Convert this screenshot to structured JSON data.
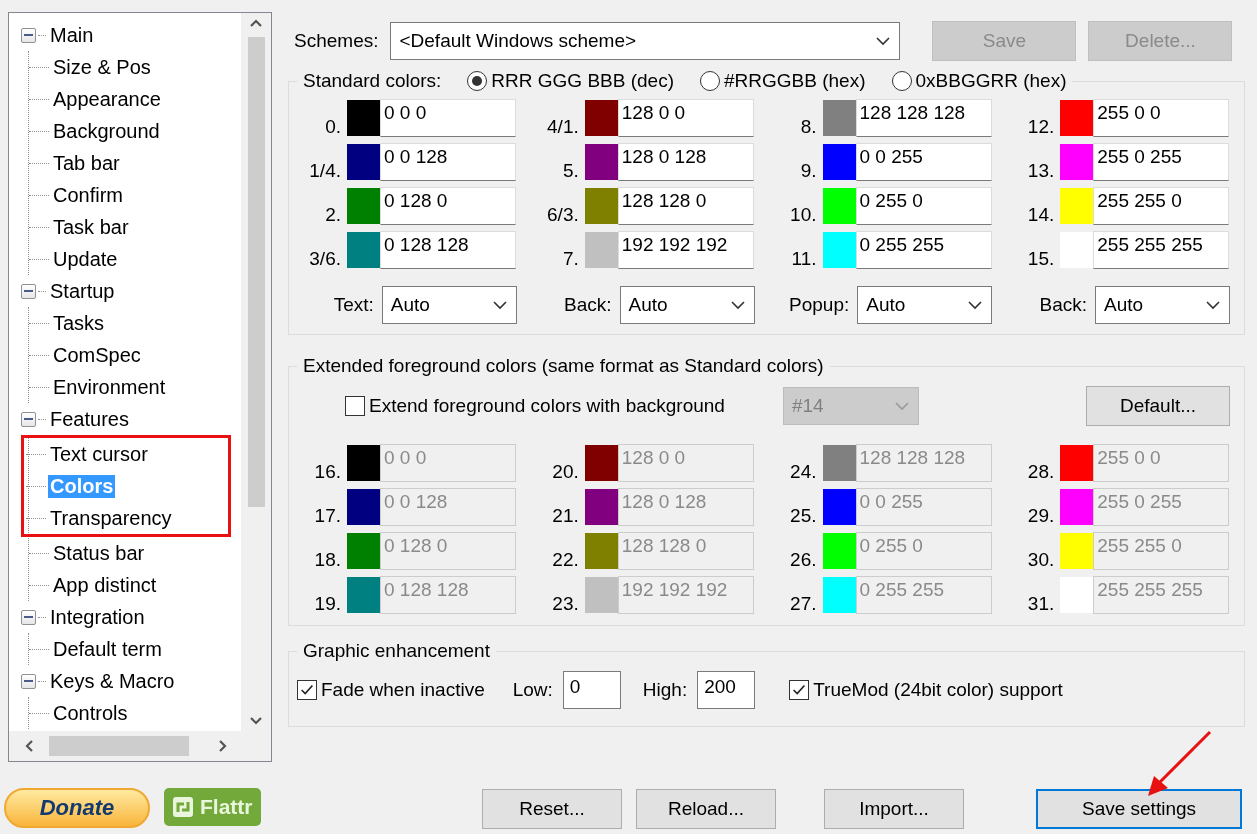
{
  "tree": [
    {
      "label": "Main",
      "expanded": true,
      "selected": false,
      "children": [
        {
          "label": "Size & Pos",
          "selected": false
        },
        {
          "label": "Appearance",
          "selected": false
        },
        {
          "label": "Background",
          "selected": false
        },
        {
          "label": "Tab bar",
          "selected": false
        },
        {
          "label": "Confirm",
          "selected": false
        },
        {
          "label": "Task bar",
          "selected": false
        },
        {
          "label": "Update",
          "selected": false
        }
      ]
    },
    {
      "label": "Startup",
      "expanded": true,
      "selected": false,
      "children": [
        {
          "label": "Tasks",
          "selected": false
        },
        {
          "label": "ComSpec",
          "selected": false
        },
        {
          "label": "Environment",
          "selected": false
        }
      ]
    },
    {
      "label": "Features",
      "expanded": true,
      "selected": false,
      "children": [
        {
          "label": "Text cursor",
          "selected": false,
          "framed": true
        },
        {
          "label": "Colors",
          "selected": true,
          "framed": true
        },
        {
          "label": "Transparency",
          "selected": false,
          "framed": true
        },
        {
          "label": "Status bar",
          "selected": false,
          "framed": false
        },
        {
          "label": "App distinct",
          "selected": false,
          "framed": false
        }
      ]
    },
    {
      "label": "Integration",
      "expanded": true,
      "selected": false,
      "children": [
        {
          "label": "Default term",
          "selected": false
        }
      ]
    },
    {
      "label": "Keys & Macro",
      "expanded": true,
      "selected": false,
      "children": [
        {
          "label": "Controls",
          "selected": false
        }
      ]
    }
  ],
  "side_buttons": [
    {
      "kind": "donate",
      "label": "Donate"
    },
    {
      "kind": "flattr",
      "label": "Flattr"
    }
  ],
  "schemes": {
    "label": "Schemes:",
    "value": "<Default Windows scheme>",
    "buttons": [
      {
        "label": "Save",
        "disabled": true
      },
      {
        "label": "Delete...",
        "disabled": true
      }
    ]
  },
  "standard": {
    "title": "Standard colors:",
    "fields_disabled": false,
    "formats": [
      {
        "label": "RRR GGG BBB (dec)",
        "selected": true
      },
      {
        "label": "#RRGGBB (hex)",
        "selected": false
      },
      {
        "label": "0xBBGGRR (hex)",
        "selected": false
      }
    ],
    "colors": [
      {
        "label": "0.",
        "color": "#000000",
        "value": "0 0 0"
      },
      {
        "label": "4/1.",
        "color": "#800000",
        "value": "128 0 0"
      },
      {
        "label": "8.",
        "color": "#808080",
        "value": "128 128 128"
      },
      {
        "label": "12.",
        "color": "#ff0000",
        "value": "255 0 0"
      },
      {
        "label": "1/4.",
        "color": "#000080",
        "value": "0 0 128"
      },
      {
        "label": "5.",
        "color": "#800080",
        "value": "128 0 128"
      },
      {
        "label": "9.",
        "color": "#0000ff",
        "value": "0 0 255"
      },
      {
        "label": "13.",
        "color": "#ff00ff",
        "value": "255 0 255"
      },
      {
        "label": "2.",
        "color": "#008000",
        "value": "0 128 0"
      },
      {
        "label": "6/3.",
        "color": "#808000",
        "value": "128 128 0"
      },
      {
        "label": "10.",
        "color": "#00ff00",
        "value": "0 255 0"
      },
      {
        "label": "14.",
        "color": "#ffff00",
        "value": "255 255 0"
      },
      {
        "label": "3/6.",
        "color": "#008080",
        "value": "0 128 128"
      },
      {
        "label": "7.",
        "color": "#c0c0c0",
        "value": "192 192 192"
      },
      {
        "label": "11.",
        "color": "#00ffff",
        "value": "0 255 255"
      },
      {
        "label": "15.",
        "color": "#ffffff",
        "value": "255 255 255"
      }
    ],
    "dropdowns": [
      {
        "label": "Text:",
        "value": "Auto"
      },
      {
        "label": "Back:",
        "value": "Auto"
      },
      {
        "label": "Popup:",
        "value": "Auto"
      },
      {
        "label": "Back:",
        "value": "Auto"
      }
    ]
  },
  "extended": {
    "title": "Extended foreground colors (same format as Standard colors)",
    "fields_disabled": true,
    "checkbox": {
      "label": "Extend foreground colors with background",
      "checked": false
    },
    "dropdown": {
      "value": "#14",
      "disabled": true
    },
    "button": "Default...",
    "colors": [
      {
        "label": "16.",
        "color": "#000000",
        "value": "0 0 0"
      },
      {
        "label": "20.",
        "color": "#800000",
        "value": "128 0 0"
      },
      {
        "label": "24.",
        "color": "#808080",
        "value": "128 128 128"
      },
      {
        "label": "28.",
        "color": "#ff0000",
        "value": "255 0 0"
      },
      {
        "label": "17.",
        "color": "#000080",
        "value": "0 0 128"
      },
      {
        "label": "21.",
        "color": "#800080",
        "value": "128 0 128"
      },
      {
        "label": "25.",
        "color": "#0000ff",
        "value": "0 0 255"
      },
      {
        "label": "29.",
        "color": "#ff00ff",
        "value": "255 0 255"
      },
      {
        "label": "18.",
        "color": "#008000",
        "value": "0 128 0"
      },
      {
        "label": "22.",
        "color": "#808000",
        "value": "128 128 0"
      },
      {
        "label": "26.",
        "color": "#00ff00",
        "value": "0 255 0"
      },
      {
        "label": "30.",
        "color": "#ffff00",
        "value": "255 255 0"
      },
      {
        "label": "19.",
        "color": "#008080",
        "value": "0 128 128"
      },
      {
        "label": "23.",
        "color": "#c0c0c0",
        "value": "192 192 192"
      },
      {
        "label": "27.",
        "color": "#00ffff",
        "value": "0 255 255"
      },
      {
        "label": "31.",
        "color": "#ffffff",
        "value": "255 255 255"
      }
    ]
  },
  "graphic": {
    "title": "Graphic enhancement",
    "fade": {
      "label": "Fade when inactive",
      "checked": true
    },
    "low": {
      "label": "Low:",
      "value": "0"
    },
    "high": {
      "label": "High:",
      "value": "200"
    },
    "truemod": {
      "label": "TrueMod (24bit color) support",
      "checked": true
    }
  },
  "bottom_buttons": [
    {
      "label": "Reset...",
      "focused": false
    },
    {
      "label": "Reload...",
      "focused": false
    },
    {
      "label": "Import...",
      "focused": false
    },
    {
      "label": "Save settings",
      "focused": true
    }
  ]
}
